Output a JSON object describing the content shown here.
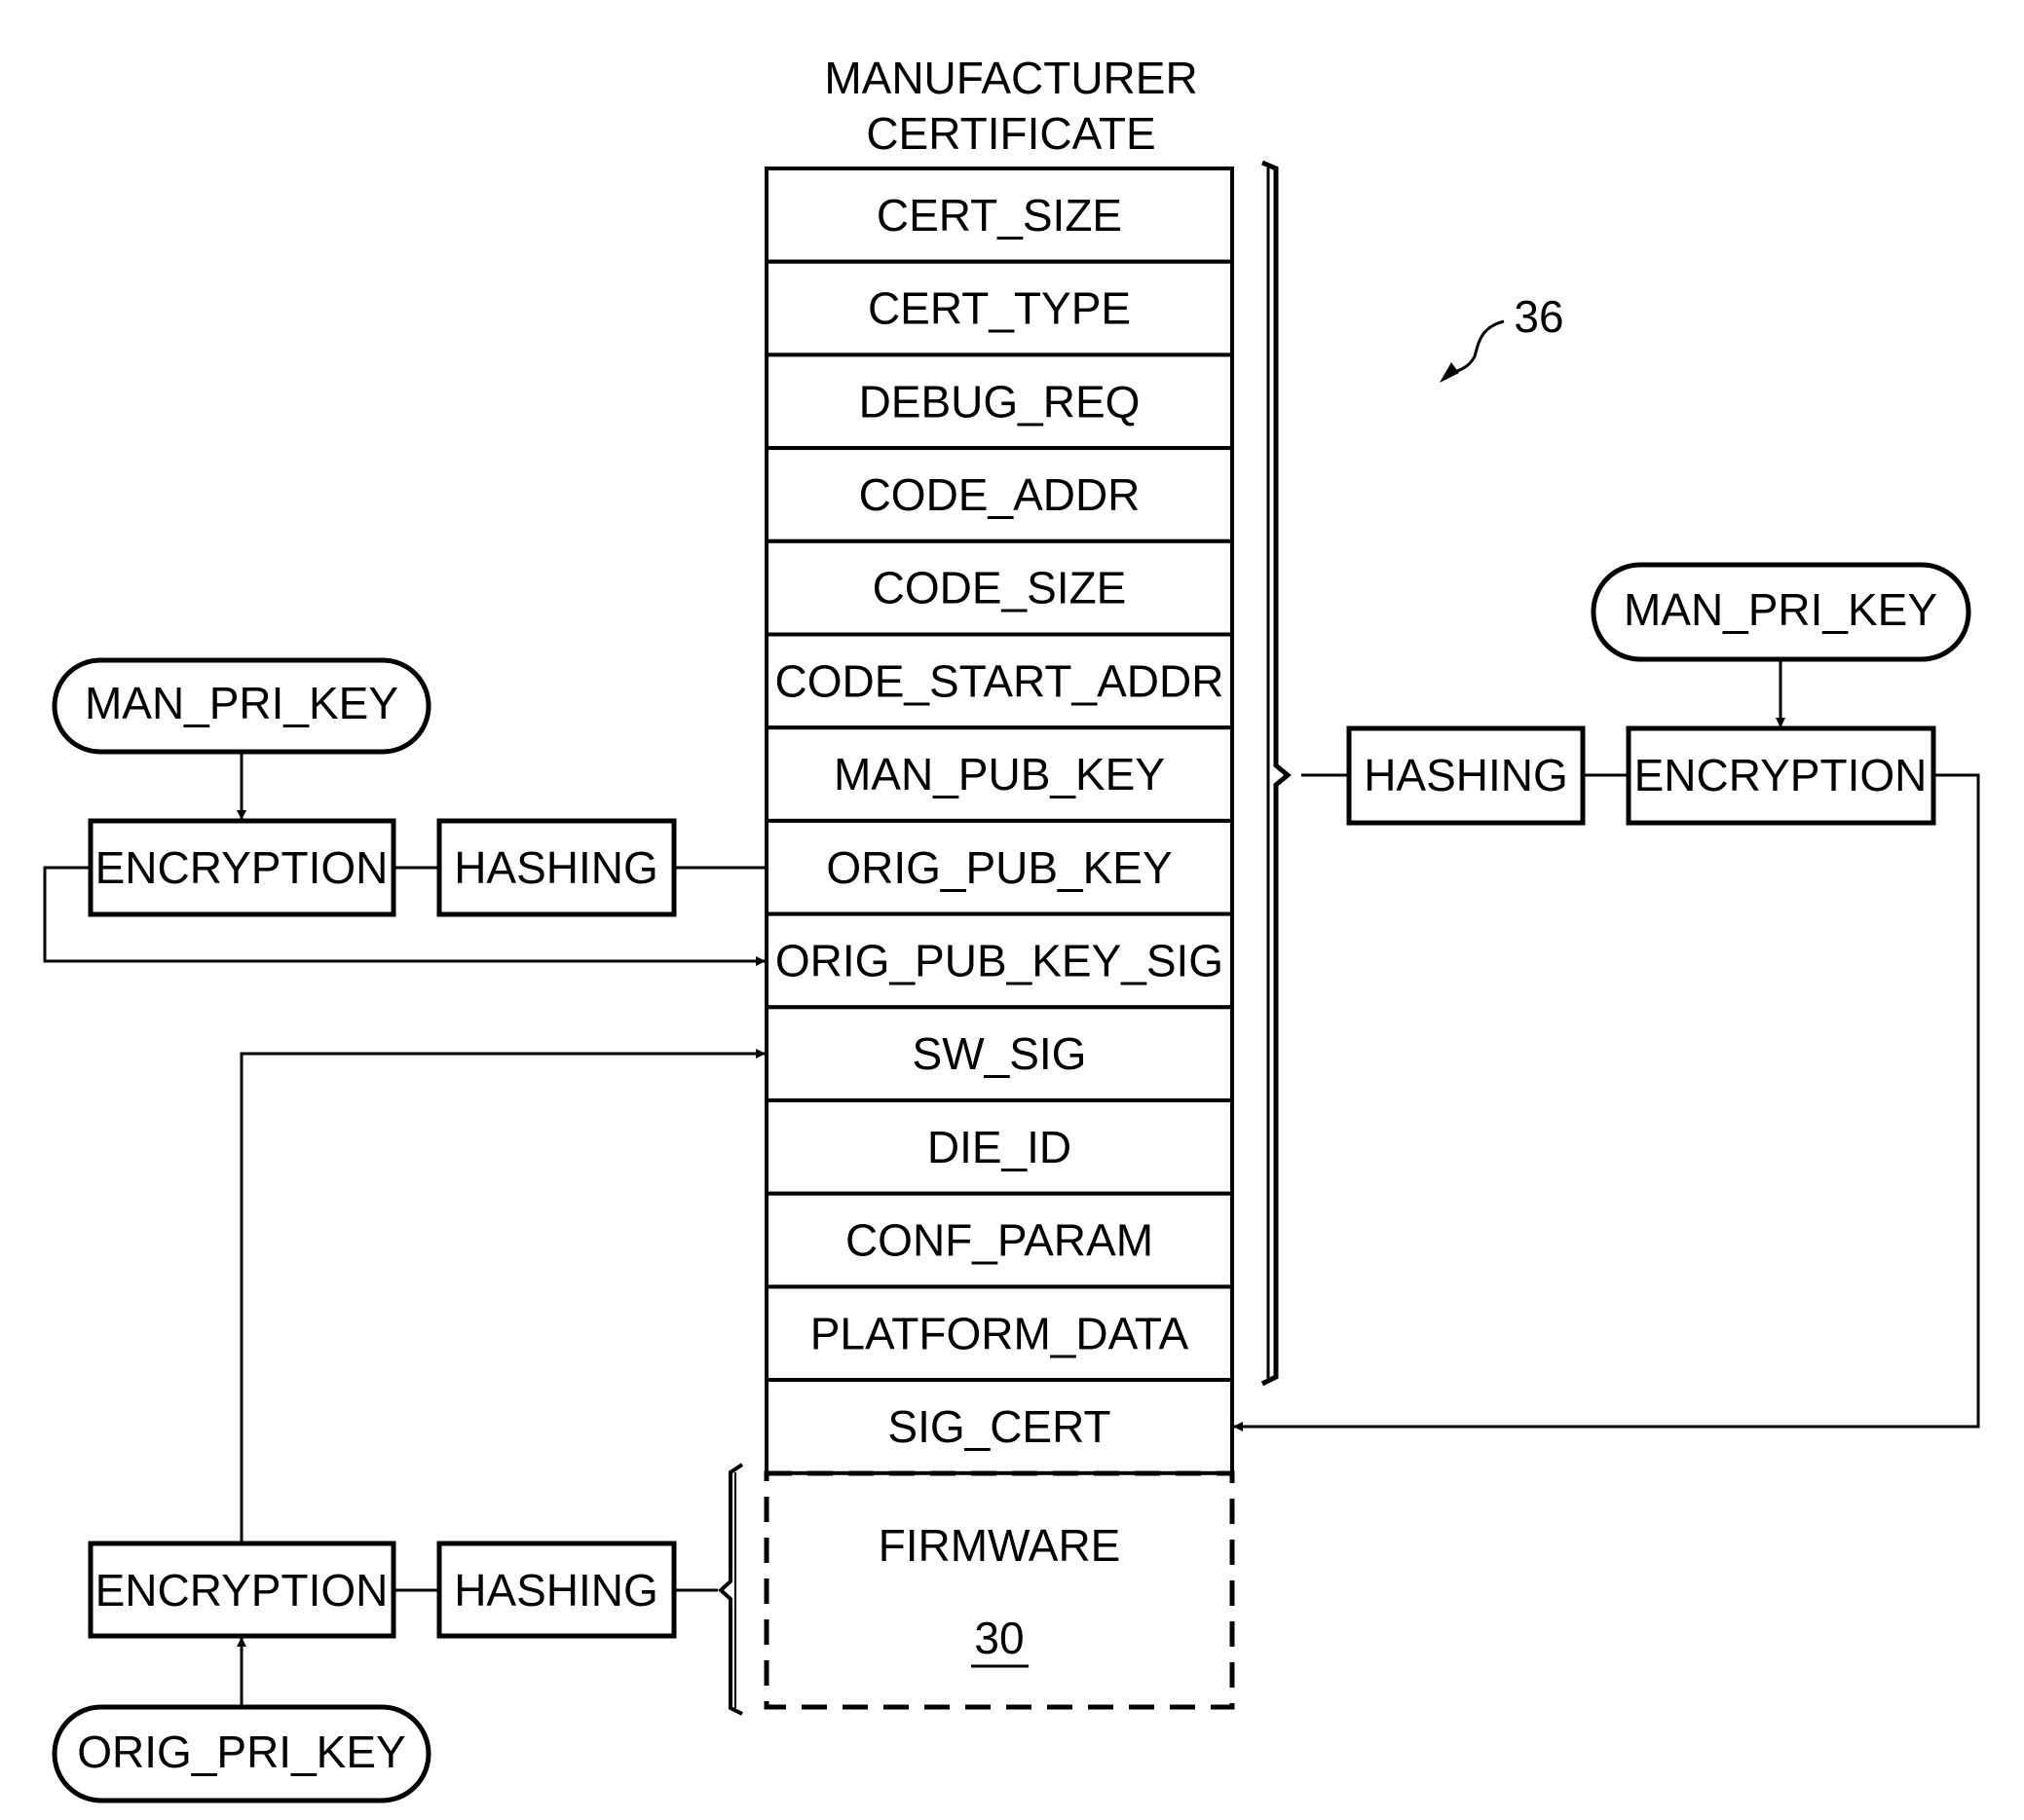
{
  "title": {
    "line1": "MANUFACTURER",
    "line2": "CERTIFICATE"
  },
  "reference_numeral": "36",
  "certificate_fields": [
    "CERT_SIZE",
    "CERT_TYPE",
    "DEBUG_REQ",
    "CODE_ADDR",
    "CODE_SIZE",
    "CODE_START_ADDR",
    "MAN_PUB_KEY",
    "ORIG_PUB_KEY",
    "ORIG_PUB_KEY_SIG",
    "SW_SIG",
    "DIE_ID",
    "CONF_PARAM",
    "PLATFORM_DATA",
    "SIG_CERT"
  ],
  "firmware": {
    "label": "FIRMWARE",
    "numeral": "30"
  },
  "left_top_flow": {
    "key": "MAN_PRI_KEY",
    "encryption": "ENCRYPTION",
    "hashing": "HASHING",
    "input_field": "ORIG_PUB_KEY",
    "output_field": "ORIG_PUB_KEY_SIG"
  },
  "left_bottom_flow": {
    "key": "ORIG_PRI_KEY",
    "encryption": "ENCRYPTION",
    "hashing": "HASHING",
    "input": "FIRMWARE",
    "output_field": "SW_SIG"
  },
  "right_flow": {
    "key": "MAN_PRI_KEY",
    "hashing": "HASHING",
    "encryption": "ENCRYPTION",
    "input_range": [
      "CERT_SIZE",
      "PLATFORM_DATA"
    ],
    "output_field": "SIG_CERT"
  }
}
